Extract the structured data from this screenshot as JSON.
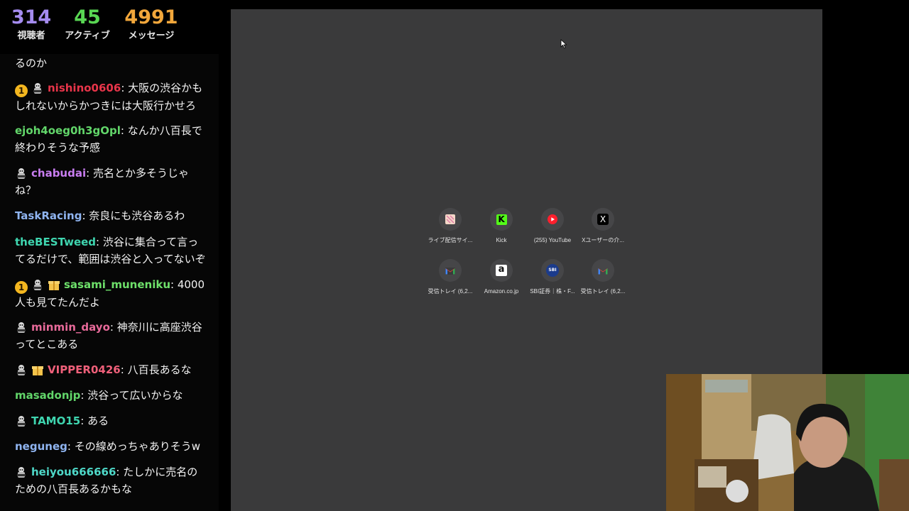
{
  "stats": {
    "viewers": {
      "value": "314",
      "label": "視聴者",
      "color": "#a58cf0"
    },
    "active": {
      "value": "45",
      "label": "アクティブ",
      "color": "#59d653"
    },
    "messages": {
      "value": "4991",
      "label": "メッセージ",
      "color": "#f2a73b"
    }
  },
  "chat": {
    "partial_top_text": "るのか",
    "messages": [
      {
        "user": "nishino0606",
        "user_color": "#e8354a",
        "badges": [
          "1",
          "bot"
        ],
        "text": "大阪の渋谷かもしれないからかつきには大阪行かせろ"
      },
      {
        "user": "ejoh4oeg0h3gOpl",
        "user_color": "#62d66a",
        "badges": [],
        "text": "なんか八百長で終わりそうな予感"
      },
      {
        "user": "chabudai",
        "user_color": "#c87df0",
        "badges": [
          "bot"
        ],
        "text": "売名とか多そうじゃね？"
      },
      {
        "user": "TaskRacing",
        "user_color": "#8fb4f0",
        "badges": [],
        "text": "奈良にも渋谷あるわ"
      },
      {
        "user": "theBESTweed",
        "user_color": "#3fd6b0",
        "badges": [],
        "text": "渋谷に集合って言ってるだけで、範囲は渋谷と入ってないぞ"
      },
      {
        "user": "sasami_muneniku",
        "user_color": "#6ee06a",
        "badges": [
          "1",
          "bot",
          "gift"
        ],
        "text": "4000人も見てたんだよ"
      },
      {
        "user": "minmin_dayo",
        "user_color": "#e86a9a",
        "badges": [
          "bot"
        ],
        "text": "神奈川に高座渋谷ってとこある"
      },
      {
        "user": "VIPPER0426",
        "user_color": "#f0607a",
        "badges": [
          "bot",
          "gift"
        ],
        "text": "八百長あるな"
      },
      {
        "user": "masadonjp",
        "user_color": "#62d66a",
        "badges": [],
        "text": "渋谷って広いからな"
      },
      {
        "user": "TAMO15",
        "user_color": "#3fd6b0",
        "badges": [
          "bot"
        ],
        "text": "ある"
      },
      {
        "user": "neguneg",
        "user_color": "#8fb4f0",
        "badges": [],
        "text": "その線めっちゃありそうw"
      },
      {
        "user": "heiyou666666",
        "user_color": "#4ed8c8",
        "badges": [
          "bot"
        ],
        "text": "たしかに売名のための八百長あるかもな"
      }
    ]
  },
  "browser": {
    "shortcuts": [
      {
        "label": "ライブ配信サイ...",
        "icon": "live-stream-site-icon"
      },
      {
        "label": "Kick",
        "icon": "kick-icon"
      },
      {
        "label": "(255) YouTube",
        "icon": "youtube-icon"
      },
      {
        "label": "Xユーザーの介...",
        "icon": "x-icon"
      },
      {
        "label": "受信トレイ (6,2...",
        "icon": "gmail-icon"
      },
      {
        "label": "Amazon.co.jp",
        "icon": "amazon-icon"
      },
      {
        "label": "SBI証券｜株・F...",
        "icon": "sbi-icon"
      },
      {
        "label": "受信トレイ (6,2...",
        "icon": "gmail-icon"
      }
    ],
    "icon_text": {
      "kick": "K",
      "x": "X",
      "amazon": "a",
      "sbi": "SBI"
    }
  },
  "colors": {
    "browser_bg": "#3a3a3b",
    "chat_bg": "#060606"
  }
}
